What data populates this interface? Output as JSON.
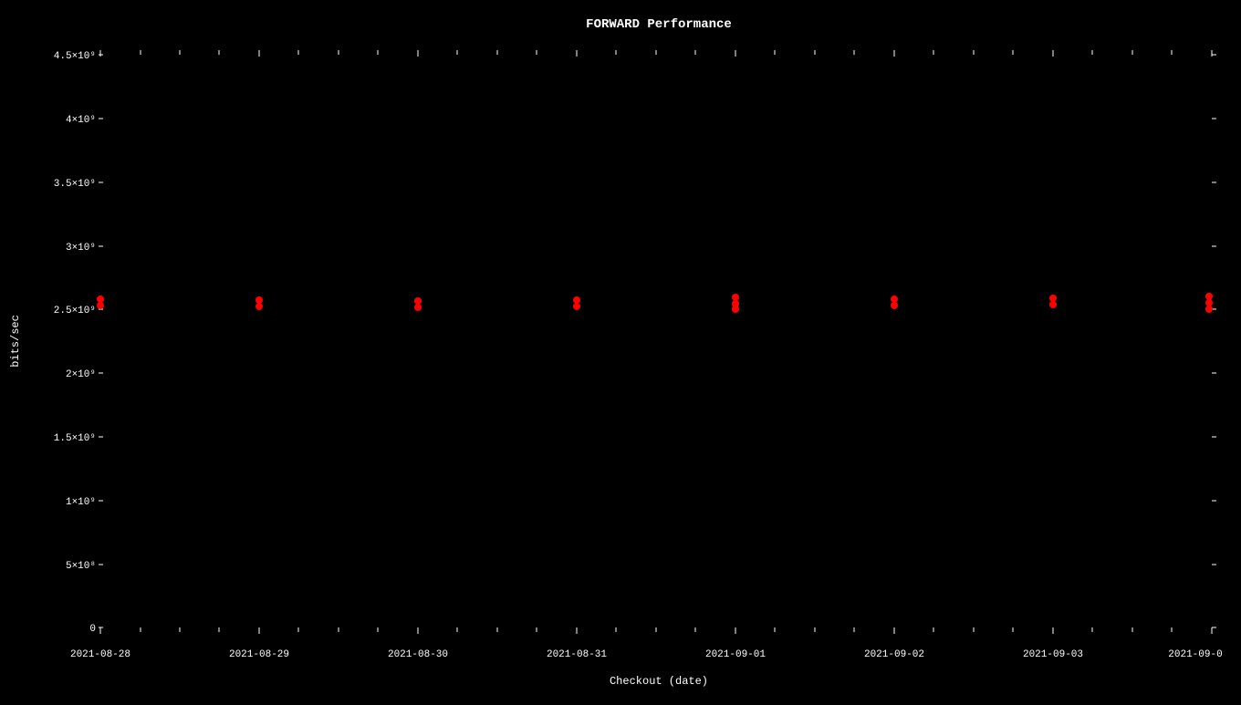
{
  "chart": {
    "title": "FORWARD Performance",
    "x_axis_label": "Checkout (date)",
    "y_axis_label": "bits/sec",
    "background_color": "#000000",
    "text_color": "#ffffff",
    "data_point_color": "#ff0000",
    "y_axis": {
      "ticks": [
        {
          "label": "0",
          "value": 0
        },
        {
          "label": "5×10⁸",
          "value": 500000000
        },
        {
          "label": "1×10⁹",
          "value": 1000000000
        },
        {
          "label": "1.5×10⁹",
          "value": 1500000000
        },
        {
          "label": "2×10⁹",
          "value": 2000000000
        },
        {
          "label": "2.5×10⁹",
          "value": 2500000000
        },
        {
          "label": "3×10⁹",
          "value": 3000000000
        },
        {
          "label": "3.5×10⁹",
          "value": 3500000000
        },
        {
          "label": "4×10⁹",
          "value": 4000000000
        },
        {
          "label": "4.5×10⁹",
          "value": 4500000000
        }
      ]
    },
    "x_axis": {
      "ticks": [
        "2021-08-28",
        "2021-08-29",
        "2021-08-30",
        "2021-08-31",
        "2021-09-01",
        "2021-09-02",
        "2021-09-03",
        "2021-09-0"
      ]
    },
    "data_points": [
      {
        "date": "2021-08-28",
        "value": 2580000000
      },
      {
        "date": "2021-08-28",
        "value": 2540000000
      },
      {
        "date": "2021-08-29",
        "value": 2580000000
      },
      {
        "date": "2021-08-29",
        "value": 2540000000
      },
      {
        "date": "2021-08-30",
        "value": 2570000000
      },
      {
        "date": "2021-08-30",
        "value": 2530000000
      },
      {
        "date": "2021-08-31",
        "value": 2570000000
      },
      {
        "date": "2021-08-31",
        "value": 2530000000
      },
      {
        "date": "2021-09-01",
        "value": 2590000000
      },
      {
        "date": "2021-09-01",
        "value": 2560000000
      },
      {
        "date": "2021-09-01",
        "value": 2530000000
      },
      {
        "date": "2021-09-02",
        "value": 2580000000
      },
      {
        "date": "2021-09-02",
        "value": 2550000000
      },
      {
        "date": "2021-09-03",
        "value": 2590000000
      },
      {
        "date": "2021-09-03",
        "value": 2560000000
      },
      {
        "date": "2021-09-04",
        "value": 2600000000
      },
      {
        "date": "2021-09-04",
        "value": 2570000000
      },
      {
        "date": "2021-09-04",
        "value": 2540000000
      }
    ]
  }
}
